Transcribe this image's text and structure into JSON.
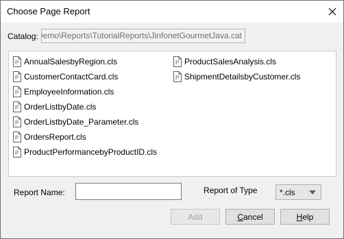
{
  "window": {
    "title": "Choose Page Report"
  },
  "catalog": {
    "label": "Catalog:",
    "value": "ner\\Demo\\Reports\\TutorialReports\\JinfonetGourmetJava.cat"
  },
  "reports": {
    "col1": [
      "AnnualSalesbyRegion.cls",
      "CustomerContactCard.cls",
      "EmployeeInformation.cls",
      "OrderListbyDate.cls",
      "OrderListbyDate_Parameter.cls",
      "OrdersReport.cls",
      "ProductPerformancebyProductID.cls"
    ],
    "col2": [
      "ProductSalesAnalysis.cls",
      "ShipmentDetailsbyCustomer.cls"
    ]
  },
  "form": {
    "report_name_label": "Report Name:",
    "report_name_value": "",
    "report_type_label": "Report of Type",
    "report_type_value": "*.cls"
  },
  "buttons": {
    "add": "Add",
    "cancel_first": "C",
    "cancel_rest": "ancel",
    "help_first": "H",
    "help_rest": "elp"
  },
  "icons": {
    "file": "page-report-file-icon",
    "close": "close-icon",
    "dropdown": "chevron-down-icon"
  }
}
